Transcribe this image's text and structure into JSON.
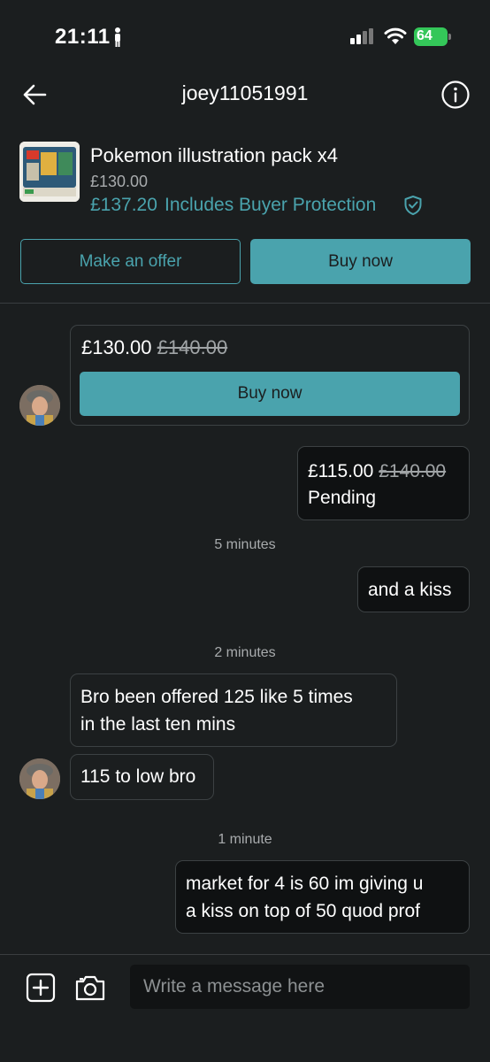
{
  "status_bar": {
    "time": "21:11",
    "battery": "64"
  },
  "header": {
    "title": "joey11051991"
  },
  "product": {
    "title": "Pokemon illustration pack x4",
    "price": "£130.00",
    "total_price": "£137.20",
    "protection_label": "Includes Buyer Protection",
    "offer_button": "Make an offer",
    "buy_button": "Buy now"
  },
  "chat": {
    "offer_card": {
      "price": "£130.00",
      "old_price": "£140.00",
      "buy_button": "Buy now"
    },
    "my_offer": {
      "price": "£115.00",
      "old_price": "£140.00",
      "status": "Pending"
    },
    "time_1": "5 minutes",
    "msg_kiss": "and a kiss",
    "time_2": "2 minutes",
    "msg_offered_line1": "Bro been offered 125 like 5 times",
    "msg_offered_line2": "in the last ten mins",
    "msg_too_low": "115 to low bro",
    "time_3": "1 minute",
    "msg_market_line1": "market for 4 is 60 im giving u",
    "msg_market_line2": "a kiss on top of 50 quod prof"
  },
  "composer": {
    "placeholder": "Write a message here"
  },
  "colors": {
    "background": "#1b1e1f",
    "accent": "#4aa3ad",
    "battery": "#34c759"
  },
  "icons": [
    "person-icon",
    "signal-icon",
    "wifi-icon",
    "battery-icon",
    "back-arrow-icon",
    "info-icon",
    "shield-check-icon",
    "add-icon",
    "camera-icon"
  ]
}
